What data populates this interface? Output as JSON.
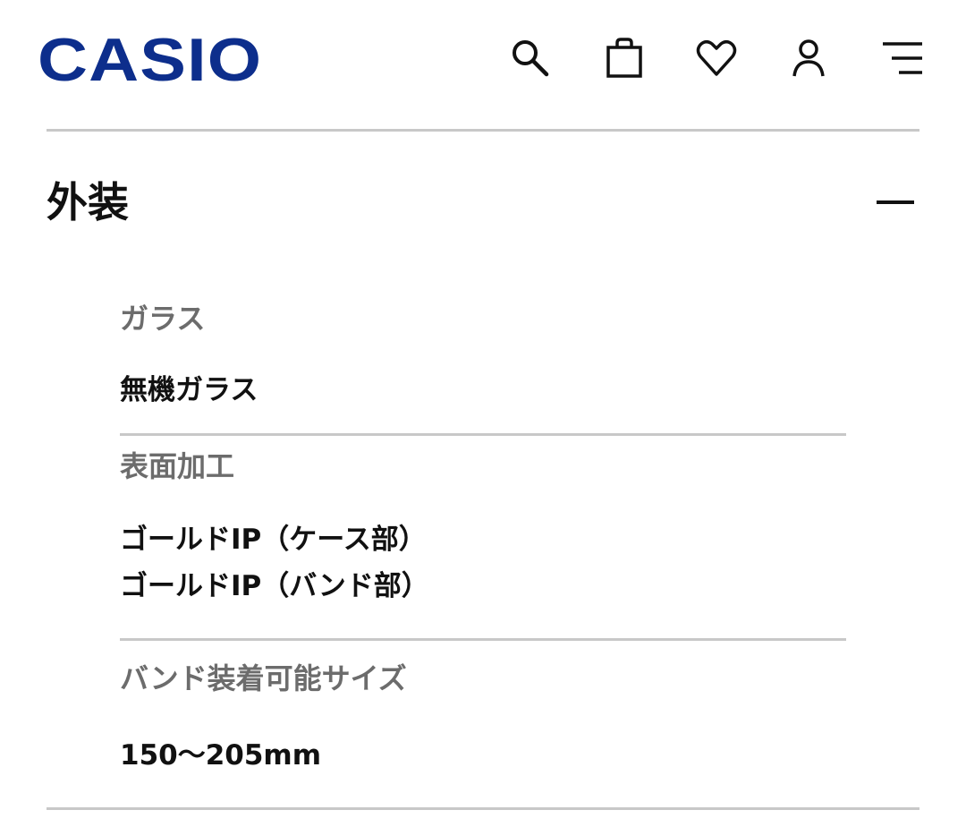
{
  "header": {
    "logo_text": "CASIO",
    "brand_color": "#0d2e8c",
    "icons": [
      "search-icon",
      "shopping-bag-icon",
      "heart-icon",
      "user-icon",
      "menu-icon"
    ]
  },
  "section": {
    "title": "外装",
    "expanded": true
  },
  "specs": [
    {
      "label": "ガラス",
      "value": "無機ガラス"
    },
    {
      "label": "表面加工",
      "value": "ゴールドIP（ケース部）\nゴールドIP（バンド部）"
    },
    {
      "label": "バンド装着可能サイズ",
      "value": "150〜205mm"
    }
  ]
}
